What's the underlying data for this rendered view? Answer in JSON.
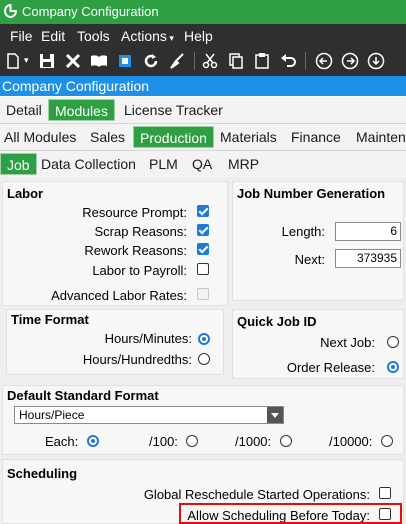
{
  "window": {
    "title": "Company Configuration"
  },
  "menubar": {
    "items": [
      "File",
      "Edit",
      "Tools",
      "Actions",
      "Help"
    ]
  },
  "toolbar": {
    "icons": [
      "new-icon",
      "save-icon",
      "delete-icon",
      "open-book-icon",
      "attach-icon",
      "refresh-icon",
      "clear-icon",
      "cut-icon",
      "copy-icon",
      "paste-icon",
      "undo-icon",
      "back-icon",
      "forward-icon",
      "down-icon"
    ]
  },
  "tree_header": "Company Configuration",
  "tabs": {
    "row1": [
      "Detail",
      "Modules",
      "License Tracker"
    ],
    "row1_selected": "Modules",
    "row2": [
      "All Modules",
      "Sales",
      "Production",
      "Materials",
      "Finance",
      "Maintena"
    ],
    "row2_selected": "Production",
    "row3": [
      "Job",
      "Data Collection",
      "PLM",
      "QA",
      "MRP"
    ],
    "row3_selected": "Job"
  },
  "labor": {
    "title": "Labor",
    "options": [
      {
        "label": "Resource Prompt:",
        "checked": true
      },
      {
        "label": "Scrap Reasons:",
        "checked": true
      },
      {
        "label": "Rework Reasons:",
        "checked": true
      },
      {
        "label": "Labor to Payroll:",
        "checked": false
      },
      {
        "label": "Advanced Labor Rates:",
        "checked": false,
        "disabled": true
      }
    ]
  },
  "time_format": {
    "title": "Time Format",
    "options": [
      {
        "label": "Hours/Minutes:",
        "selected": true
      },
      {
        "label": "Hours/Hundredths:",
        "selected": false
      }
    ]
  },
  "job_number": {
    "title": "Job Number Generation",
    "length_label": "Length:",
    "length_value": "6",
    "next_label": "Next:",
    "next_value": "373935"
  },
  "quick_job": {
    "title": "Quick Job ID",
    "options": [
      {
        "label": "Next Job:",
        "selected": false
      },
      {
        "label": "Order Release:",
        "selected": true
      }
    ]
  },
  "std_format": {
    "title": "Default Standard Format",
    "selected": "Hours/Piece",
    "options": [
      {
        "label": "Each:",
        "selected": true
      },
      {
        "label": "/100:",
        "selected": false
      },
      {
        "label": "/1000:",
        "selected": false
      },
      {
        "label": "/10000:",
        "selected": false
      }
    ]
  },
  "scheduling": {
    "title": "Scheduling",
    "options": [
      {
        "label": "Global Reschedule Started Operations:",
        "checked": false
      },
      {
        "label": "Allow Scheduling Before Today:",
        "checked": false
      }
    ]
  },
  "colors": {
    "green": "#2ea043",
    "blue": "#1e90e8",
    "highlight": "#e01010"
  }
}
